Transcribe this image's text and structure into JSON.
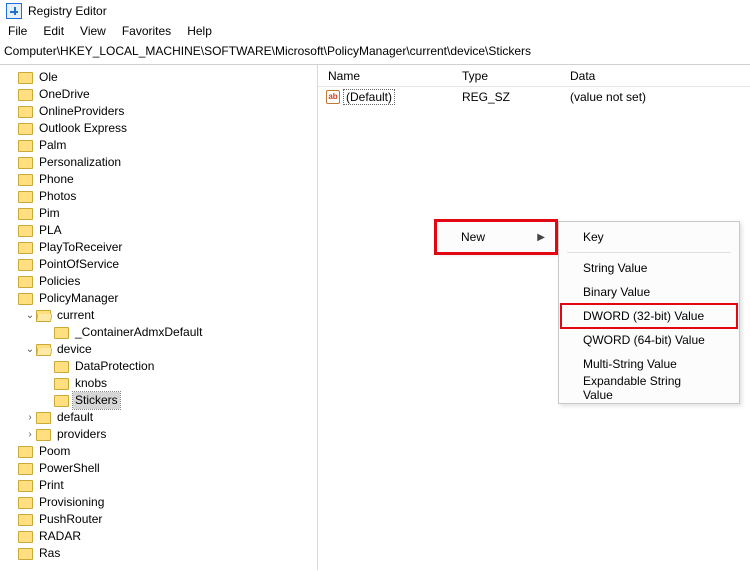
{
  "window": {
    "title": "Registry Editor"
  },
  "menu": {
    "file": "File",
    "edit": "Edit",
    "view": "View",
    "favorites": "Favorites",
    "help": "Help"
  },
  "address": "Computer\\HKEY_LOCAL_MACHINE\\SOFTWARE\\Microsoft\\PolicyManager\\current\\device\\Stickers",
  "columns": {
    "name": "Name",
    "type": "Type",
    "data": "Data"
  },
  "row": {
    "name": "(Default)",
    "type": "REG_SZ",
    "data": "(value not set)"
  },
  "tree": [
    {
      "label": "Ole",
      "depth": 0
    },
    {
      "label": "OneDrive",
      "depth": 0
    },
    {
      "label": "OnlineProviders",
      "depth": 0
    },
    {
      "label": "Outlook Express",
      "depth": 0
    },
    {
      "label": "Palm",
      "depth": 0
    },
    {
      "label": "Personalization",
      "depth": 0
    },
    {
      "label": "Phone",
      "depth": 0
    },
    {
      "label": "Photos",
      "depth": 0
    },
    {
      "label": "Pim",
      "depth": 0
    },
    {
      "label": "PLA",
      "depth": 0
    },
    {
      "label": "PlayToReceiver",
      "depth": 0
    },
    {
      "label": "PointOfService",
      "depth": 0
    },
    {
      "label": "Policies",
      "depth": 0
    },
    {
      "label": "PolicyManager",
      "depth": 0
    },
    {
      "label": "current",
      "depth": 1,
      "twisty": "down",
      "open": true
    },
    {
      "label": "_ContainerAdmxDefault",
      "depth": 2
    },
    {
      "label": "device",
      "depth": 1,
      "twisty": "down",
      "open": true
    },
    {
      "label": "DataProtection",
      "depth": 2
    },
    {
      "label": "knobs",
      "depth": 2
    },
    {
      "label": "Stickers",
      "depth": 2,
      "selected": true
    },
    {
      "label": "default",
      "depth": 1,
      "twisty": "right"
    },
    {
      "label": "providers",
      "depth": 1,
      "twisty": "right"
    },
    {
      "label": "Poom",
      "depth": 0
    },
    {
      "label": "PowerShell",
      "depth": 0
    },
    {
      "label": "Print",
      "depth": 0
    },
    {
      "label": "Provisioning",
      "depth": 0
    },
    {
      "label": "PushRouter",
      "depth": 0
    },
    {
      "label": "RADAR",
      "depth": 0
    },
    {
      "label": "Ras",
      "depth": 0
    }
  ],
  "ctx": {
    "new": "New",
    "items": {
      "key": "Key",
      "string": "String Value",
      "binary": "Binary Value",
      "dword": "DWORD (32-bit) Value",
      "qword": "QWORD (64-bit) Value",
      "multi": "Multi-String Value",
      "expand": "Expandable String Value"
    }
  }
}
